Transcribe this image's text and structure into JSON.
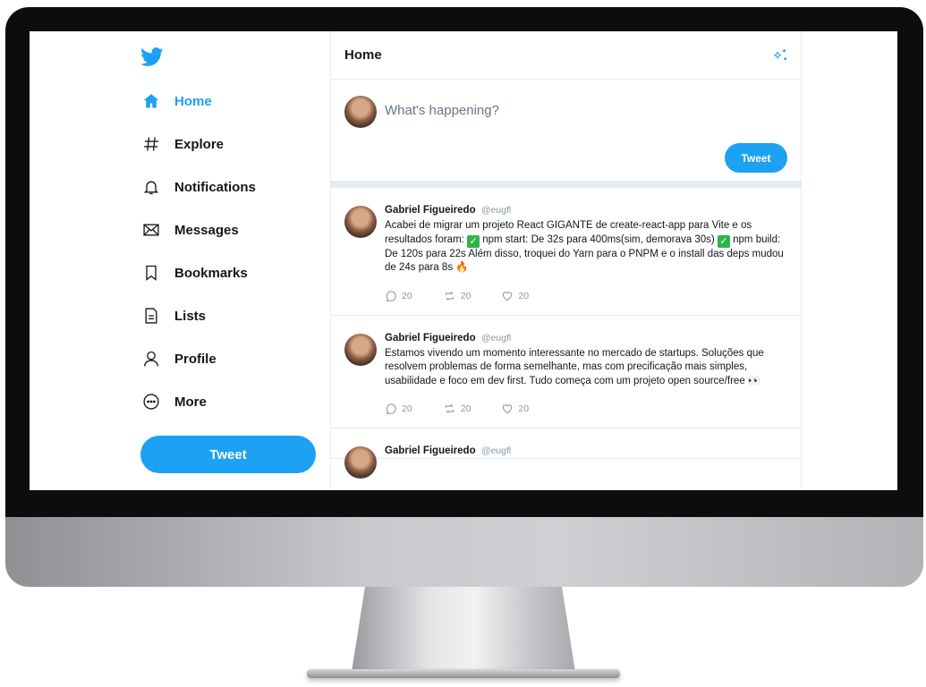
{
  "colors": {
    "accent": "#1da1f2",
    "text": "#14171a",
    "muted": "#657786",
    "border": "#e6ecf0"
  },
  "logo": {
    "icon": "twitter-bird-icon"
  },
  "nav": [
    {
      "label": "Home",
      "icon": "home-icon",
      "active": true
    },
    {
      "label": "Explore",
      "icon": "hashtag-icon"
    },
    {
      "label": "Notifications",
      "icon": "bell-icon"
    },
    {
      "label": "Messages",
      "icon": "envelope-icon"
    },
    {
      "label": "Bookmarks",
      "icon": "bookmark-icon"
    },
    {
      "label": "Lists",
      "icon": "list-icon"
    },
    {
      "label": "Profile",
      "icon": "user-icon"
    },
    {
      "label": "More",
      "icon": "more-icon"
    }
  ],
  "sidebar_tweet_label": "Tweet",
  "header": {
    "title": "Home",
    "icon": "sparkle-icon"
  },
  "composer": {
    "placeholder": "What's happening?",
    "tweet_label": "Tweet"
  },
  "tweets": [
    {
      "name": "Gabriel Figueiredo",
      "handle": "@eugfl",
      "text_parts": [
        "Acabei de migrar um projeto React GIGANTE de create-react-app para Vite e os resultados foram: ",
        " npm start: De 32s para 400ms(sim, demorava 30s) ",
        " npm build: De 120s para 22s Além disso, troquei do Yarn para o PNPM e o install das deps mudou de 24s para 8s 🔥"
      ],
      "reply_count": "20",
      "retweet_count": "20",
      "like_count": "20"
    },
    {
      "name": "Gabriel Figueiredo",
      "handle": "@eugfl",
      "text": "Estamos vivendo um momento interessante no mercado de startups. Soluções que resolvem problemas de forma semelhante, mas com precificação mais simples, usabilidade e foco em dev first. Tudo começa com um projeto open source/free 👀",
      "reply_count": "20",
      "retweet_count": "20",
      "like_count": "20"
    },
    {
      "name": "Gabriel Figueiredo",
      "handle": "@eugfl"
    }
  ]
}
